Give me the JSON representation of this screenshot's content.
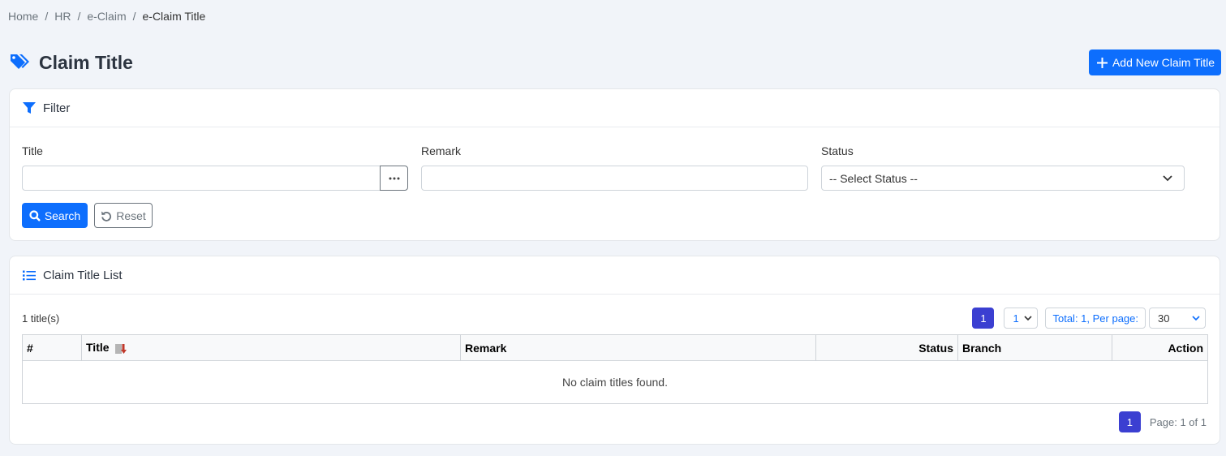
{
  "breadcrumb": {
    "items": [
      "Home",
      "HR",
      "e-Claim"
    ],
    "current": "e-Claim Title",
    "separator": "/"
  },
  "header": {
    "title": "Claim Title",
    "title_icon": "tags-icon",
    "add_button_label": "Add New Claim Title"
  },
  "filter": {
    "heading": "Filter",
    "title_label": "Title",
    "title_value": "",
    "remark_label": "Remark",
    "remark_value": "",
    "status_label": "Status",
    "status_selected": "-- Select Status --",
    "search_label": "Search",
    "reset_label": "Reset"
  },
  "list": {
    "heading": "Claim Title List",
    "count_text": "1 title(s)",
    "current_page": "1",
    "page_select_value": "1",
    "total_text": "Total: 1, Per page:",
    "per_page_value": "30",
    "columns": [
      "#",
      "Title",
      "Remark",
      "Status",
      "Branch",
      "Action"
    ],
    "empty_message": "No claim titles found.",
    "page_info": "Page: 1 of 1"
  },
  "colors": {
    "primary": "#0d6efd",
    "pager_active": "#3b3fd1",
    "background": "#f1f4f9"
  }
}
